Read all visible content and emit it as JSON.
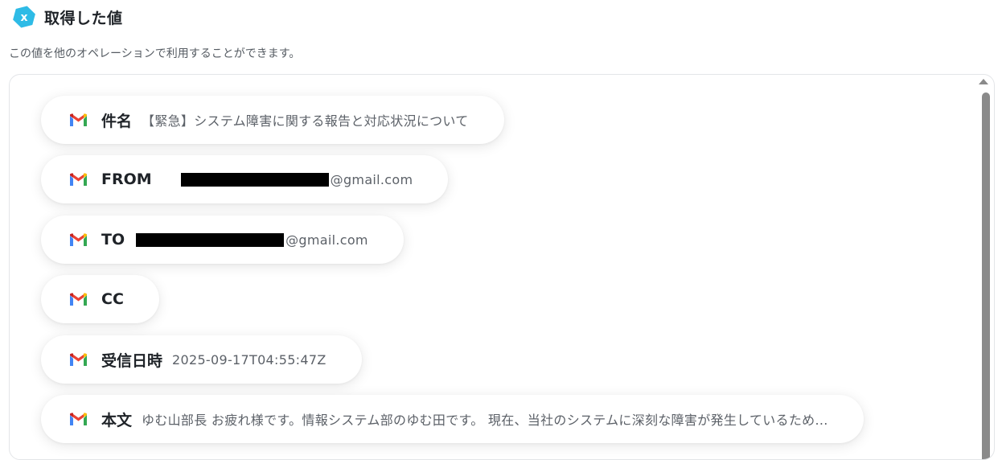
{
  "header": {
    "title": "取得した値",
    "subtitle": "この値を他のオペレーションで利用することができます。",
    "icon": "x-hexagon-icon",
    "icon_color": "#2ebbe6"
  },
  "fields": [
    {
      "label": "件名",
      "value": "【緊急】システム障害に関する報告と対応状況について",
      "icon": "gmail-icon"
    },
    {
      "label": "FROM",
      "value": "@gmail.com",
      "redacted": true,
      "icon": "gmail-icon"
    },
    {
      "label": "TO",
      "value": "@gmail.com",
      "redacted": true,
      "icon": "gmail-icon"
    },
    {
      "label": "CC",
      "value": "",
      "icon": "gmail-icon"
    },
    {
      "label": "受信日時",
      "value": "2025-09-17T04:55:47Z",
      "icon": "gmail-icon"
    },
    {
      "label": "本文",
      "value": "ゆむ山部長 お疲れ様です。情報システム部のゆむ田です。 現在、当社のシステムに深刻な障害が発生しているため...",
      "icon": "gmail-icon"
    }
  ]
}
